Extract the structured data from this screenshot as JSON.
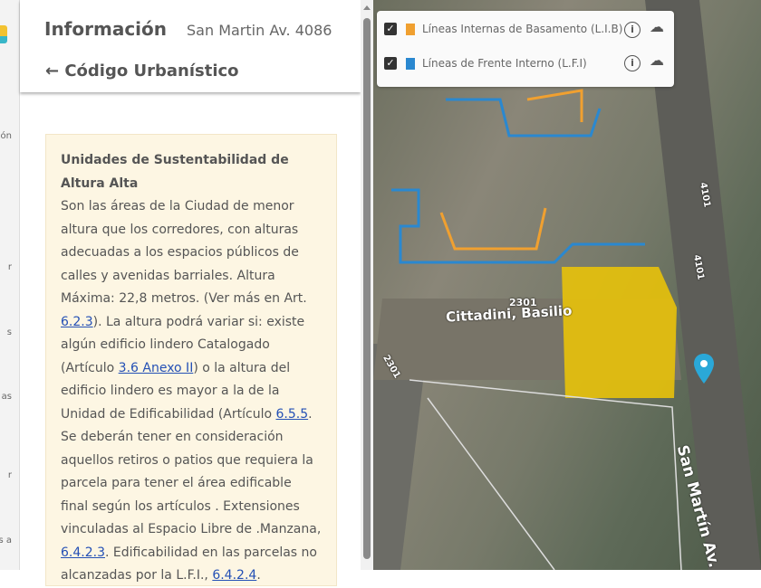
{
  "rail": {
    "fragments": [
      "ón",
      "r",
      "s",
      "as",
      "r",
      "s a"
    ]
  },
  "header": {
    "title": "Información",
    "address": "San Martin Av. 4086",
    "back_label": "← Código Urbanístico"
  },
  "card": {
    "heading": "Unidades de Sustentabilidad de Altura Alta",
    "t1": "Son las áreas de la Ciudad de menor altura que los corredores, con alturas adecuadas a los espacios públicos de calles y avenidas barriales. Altura Máxima: 22,8 metros. (Ver más en Art. ",
    "l1": "6.2.3",
    "t2": "). La altura podrá variar si: existe algún edificio lindero Catalogado (Artículo ",
    "l2": "3.6 Anexo II",
    "t3": ") o la altura del edificio lindero es mayor a la de la Unidad de Edificabilidad (Artículo ",
    "l3": "6.5.5",
    "t4": ". Se deberán tener en consideración aquellos retiros o patios que requiera la parcela para tener el área edificable final según los artículos . Extensiones vinculadas al Espacio Libre de .Manzana, ",
    "l4": "6.4.2.3",
    "t5": ". Edificabilidad en las parcelas no alcanzadas por la L.F.I., ",
    "l5": "6.4.2.4",
    "t6": "."
  },
  "legend": {
    "items": [
      {
        "label": "Líneas Internas de Basamento (L.I.B)",
        "color": "#f0a030",
        "checked": true
      },
      {
        "label": "Líneas de Frente Interno (L.F.I)",
        "color": "#2a88d0",
        "checked": true
      }
    ]
  },
  "map": {
    "labels": {
      "num1": "2301",
      "street1": "Cittadini, Basilio",
      "num2": "2301",
      "avenue": "San Martín Av.",
      "num3": "4101",
      "num4": "4101"
    }
  }
}
